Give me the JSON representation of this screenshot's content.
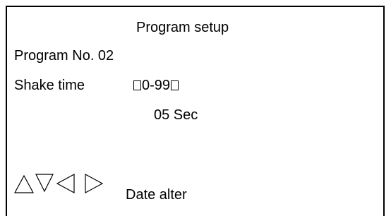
{
  "screen": {
    "title": "Program setup",
    "program_label": "Program No. 02",
    "shake_label": "Shake time",
    "shake_range": "0-99",
    "shake_value": "05 Sec"
  },
  "nav": {
    "icons": [
      "up-triangle-icon",
      "down-triangle-icon",
      "left-triangle-icon",
      "right-triangle-icon"
    ],
    "action_label": "Date alter"
  }
}
